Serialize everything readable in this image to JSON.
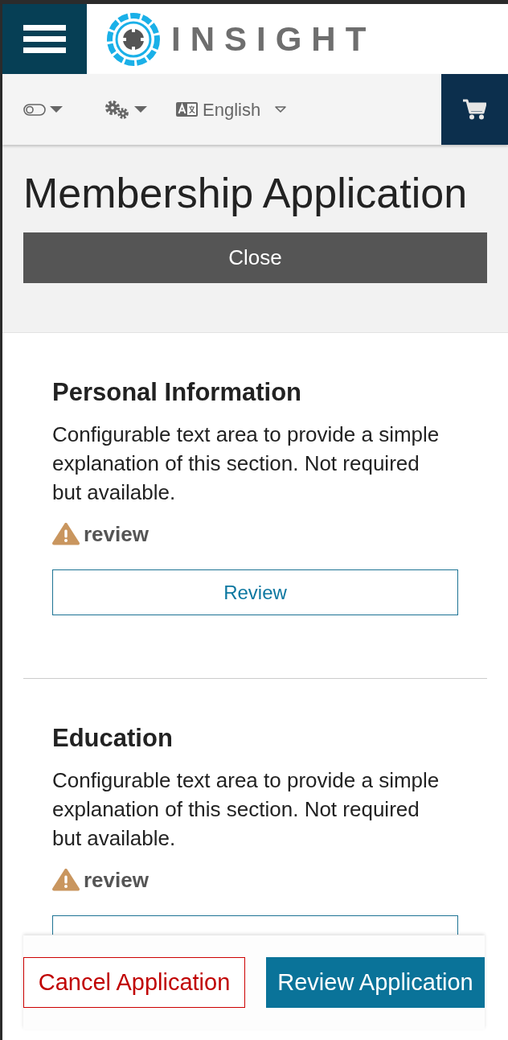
{
  "header": {
    "logo_text": "INSIGHT"
  },
  "toolbar": {
    "language": "English"
  },
  "page": {
    "title": "Membership Application",
    "close_button": "Close"
  },
  "sections": [
    {
      "title": "Personal Information",
      "description": "Configurable text area to provide a simple explanation of this section. Not required but available.",
      "status": "review",
      "button_label": "Review"
    },
    {
      "title": "Education",
      "description": "Configurable text area to provide a simple explanation of this section. Not required but available.",
      "status": "review"
    }
  ],
  "footer": {
    "buttons": [
      {
        "label": "Cancel Application",
        "kind": "outline"
      },
      {
        "label": "Review Application",
        "kind": "primary"
      }
    ]
  }
}
